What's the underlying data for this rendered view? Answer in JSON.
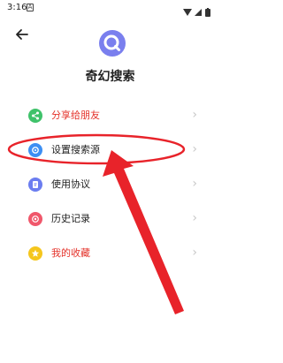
{
  "status_bar": {
    "time": "3:16",
    "notify_letter": "A"
  },
  "header": {
    "app_name": "奇幻搜索"
  },
  "menu": [
    {
      "label": "分享给朋友",
      "color": "#e4322a",
      "icon": "share-icon",
      "icon_color": "#3fc26a"
    },
    {
      "label": "设置搜索源",
      "color": "#222222",
      "icon": "settings-icon",
      "icon_color": "#3d8ff3"
    },
    {
      "label": "使用协议",
      "color": "#222222",
      "icon": "document-icon",
      "icon_color": "#6b7df0"
    },
    {
      "label": "历史记录",
      "color": "#222222",
      "icon": "history-icon",
      "icon_color": "#f0576b"
    },
    {
      "label": "我的收藏",
      "color": "#e4322a",
      "icon": "star-icon",
      "icon_color": "#f5c61d"
    }
  ],
  "colors": {
    "accent_red": "#e4322a",
    "annotation": "#e8232a",
    "logo": "#7a7fee"
  }
}
